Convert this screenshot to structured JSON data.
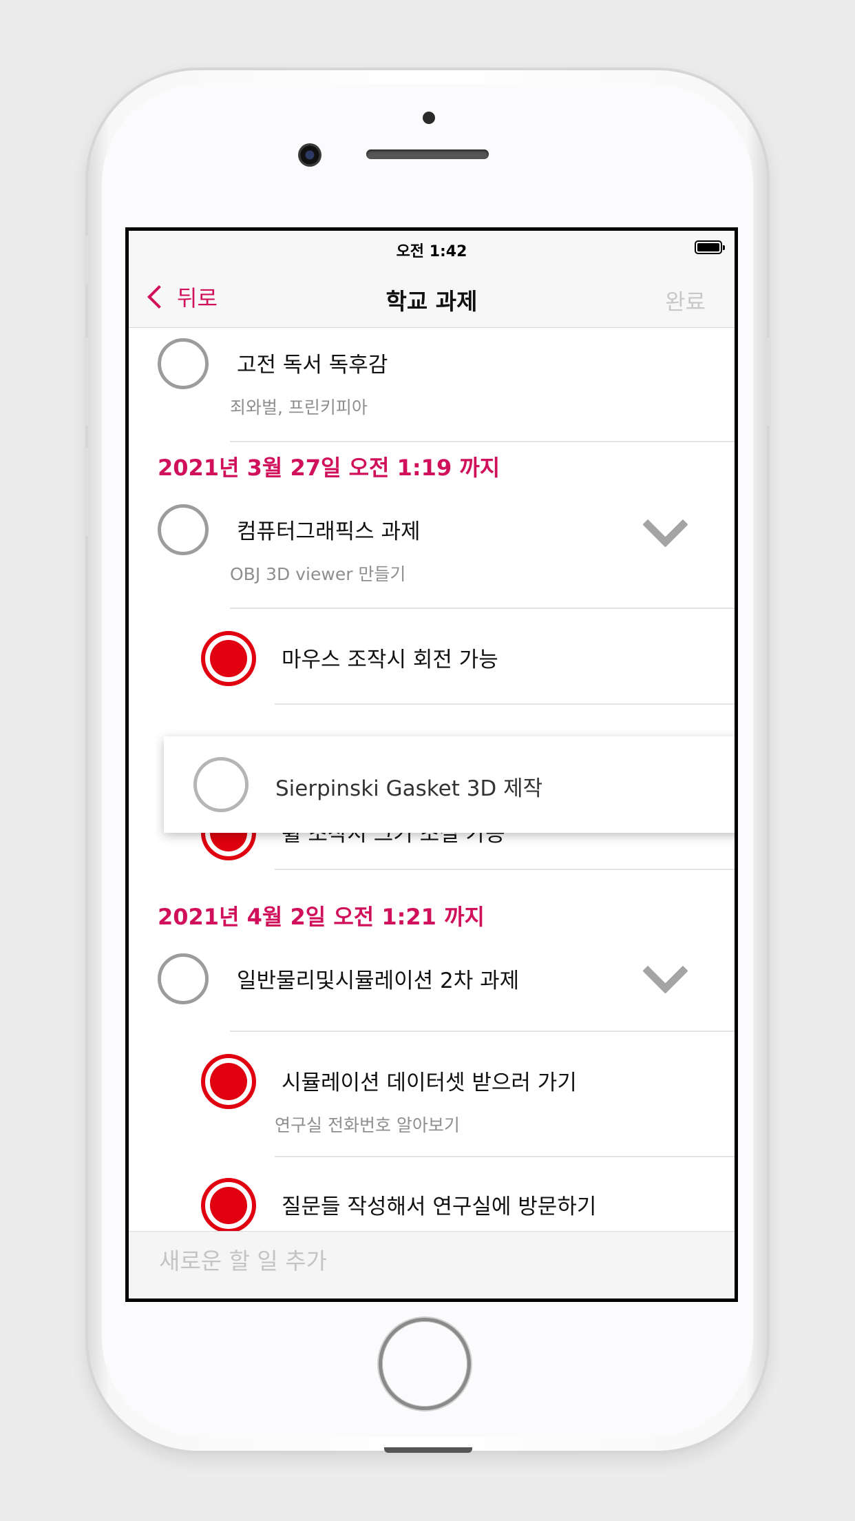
{
  "status_bar": {
    "time": "오전 1:42"
  },
  "nav": {
    "back_label": "뒤로",
    "title": "학교 과제",
    "done_label": "완료"
  },
  "items": {
    "classic_reading": {
      "title": "고전 독서 독후감",
      "subtitle": "죄와벌, 프린키피아"
    },
    "graphics_section": "2021년 3월 27일 오전 1:19 까지",
    "graphics": {
      "title": "컴퓨터그래픽스 과제",
      "subtitle": "OBJ 3D viewer 만들기"
    },
    "mouse_rotate": {
      "title": "마우스 조작시 회전 가능"
    },
    "dragging": {
      "title": "Sierpinski Gasket 3D 제작"
    },
    "wheel_zoom": {
      "title": "휠 조작시 크기 조절 가능"
    },
    "physics_section": "2021년 4월 2일 오전 1:21 까지",
    "physics": {
      "title": "일반물리및시뮬레이션 2차 과제"
    },
    "dataset": {
      "title": "시뮬레이션 데이터셋 받으러 가기",
      "subtitle": "연구실 전화번호 알아보기"
    },
    "questions": {
      "title": "질문들 작성해서 연구실에 방문하기"
    }
  },
  "add_bar": {
    "placeholder": "새로운 할 일 추가"
  },
  "colors": {
    "accent": "#d0105a",
    "done_red": "#e0000f",
    "muted": "#8e8e8e"
  },
  "icons": [
    "chevron-left-icon",
    "chevron-down-icon",
    "battery-icon",
    "checkbox-circle-icon"
  ]
}
